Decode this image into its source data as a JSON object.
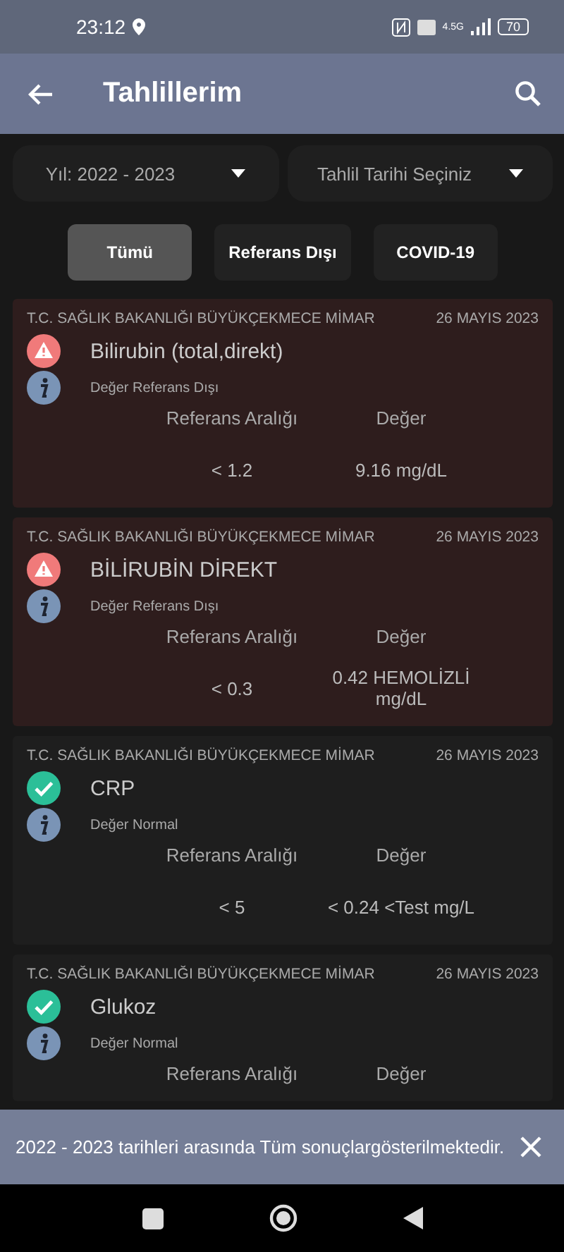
{
  "status_bar": {
    "time": "23:12",
    "network": "4.5G",
    "battery": "70"
  },
  "app_bar": {
    "title": "Tahlillerim"
  },
  "filters": [
    {
      "value": "Yıl: 2022 - 2023"
    },
    {
      "value": "Tahlil Tarihi Seçiniz"
    }
  ],
  "tabs": [
    {
      "label": "Tümü",
      "selected": true
    },
    {
      "label": "Referans Dışı",
      "selected": false
    },
    {
      "label": "COVID-19",
      "selected": false
    }
  ],
  "results": [
    {
      "kind": "warning",
      "lab": "T.C. SAĞLIK BAKANLIĞI BÜYÜKÇEKMECE MİMAR",
      "date": "26 MAYIS 2023",
      "test": "Bilirubin (total,direkt)",
      "status": "Değer Referans Dışı",
      "ref_label": "Referans Aralığı",
      "value_label": "Değer",
      "ref": "< 1.2",
      "value": "9.16 mg/dL"
    },
    {
      "kind": "warning",
      "lab": "T.C. SAĞLIK BAKANLIĞI BÜYÜKÇEKMECE MİMAR",
      "date": "26 MAYIS 2023",
      "test": "BİLİRUBİN DİREKT",
      "status": "Değer Referans Dışı",
      "ref_label": "Referans Aralığı",
      "value_label": "Değer",
      "ref": "< 0.3",
      "value": "0.42 HEMOLİZLİ mg/dL"
    },
    {
      "kind": "normal",
      "lab": "T.C. SAĞLIK BAKANLIĞI BÜYÜKÇEKMECE MİMAR",
      "date": "26 MAYIS 2023",
      "test": "CRP",
      "status": "Değer Normal",
      "ref_label": "Referans Aralığı",
      "value_label": "Değer",
      "ref": "< 5",
      "value": "< 0.24 <Test mg/L"
    },
    {
      "kind": "normal",
      "lab": "T.C. SAĞLIK BAKANLIĞI BÜYÜKÇEKMECE MİMAR",
      "date": "26 MAYIS 2023",
      "test": "Glukoz",
      "status": "Değer Normal",
      "ref_label": "Referans Aralığı",
      "value_label": "Değer"
    }
  ],
  "snackbar": {
    "message": "2022 - 2023 tarihleri arasında Tüm sonuçlargösterilmektedir."
  }
}
